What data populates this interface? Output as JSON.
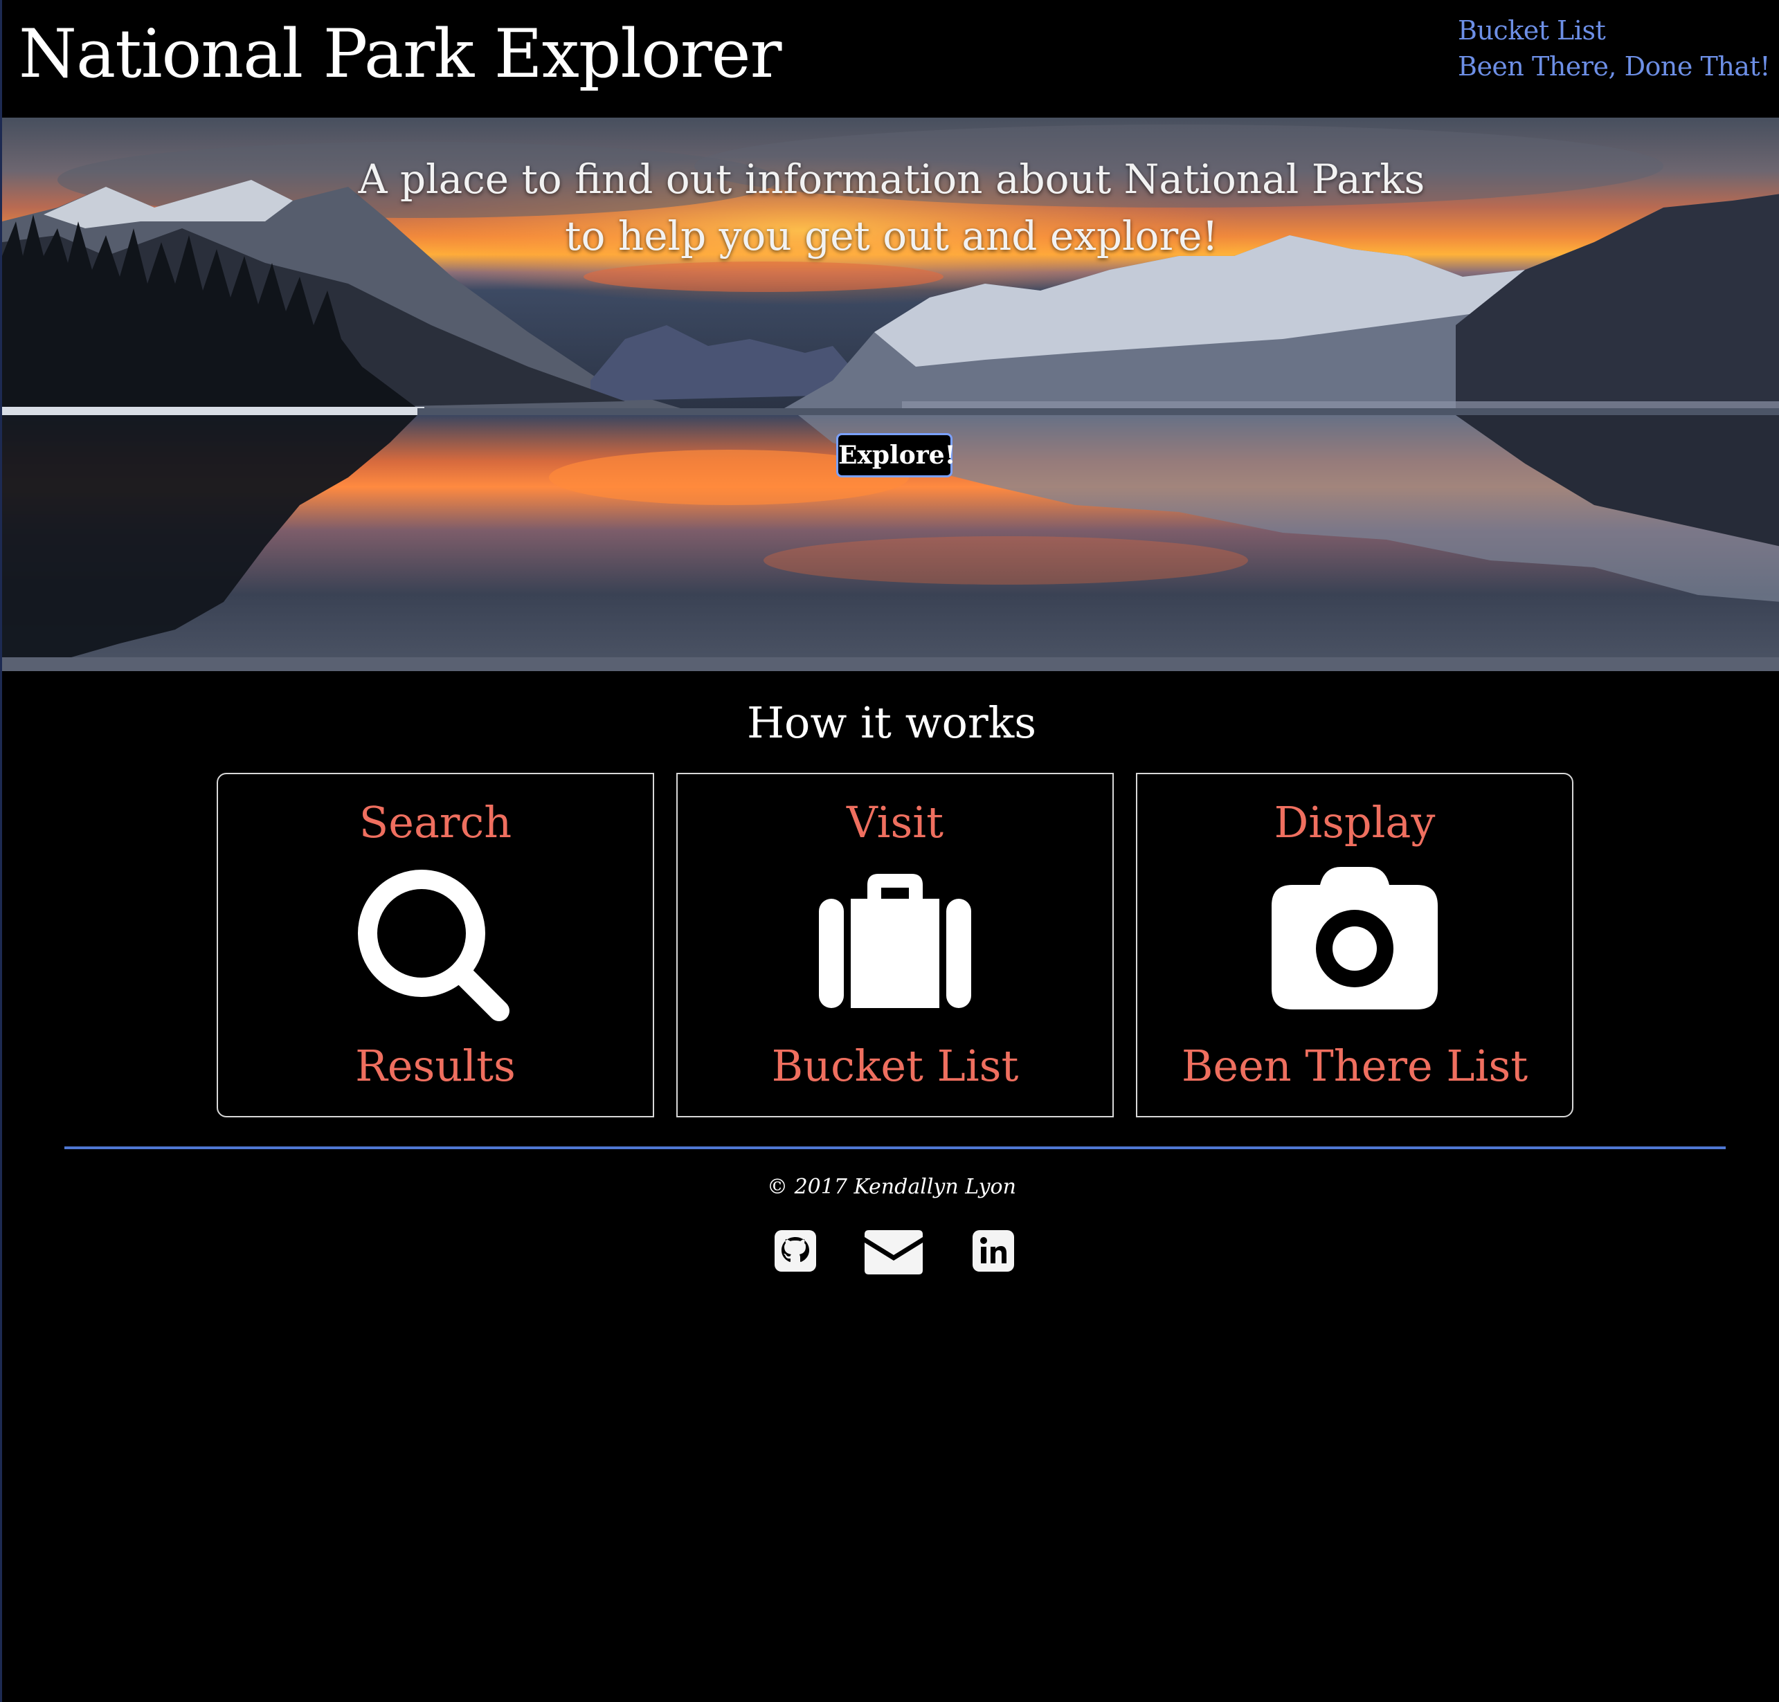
{
  "header": {
    "title": "National Park Explorer",
    "nav": [
      {
        "label": "Bucket List"
      },
      {
        "label": "Been There, Done That!"
      }
    ]
  },
  "hero": {
    "tagline_line1": "A place to find out information about National Parks",
    "tagline_line2": "to help you get out and explore!",
    "button_label": "Explore!"
  },
  "how_it_works": {
    "title": "How it works",
    "cards": [
      {
        "top": "Search",
        "bottom": "Results",
        "icon": "search-icon"
      },
      {
        "top": "Visit",
        "bottom": "Bucket List",
        "icon": "suitcase-icon"
      },
      {
        "top": "Display",
        "bottom": "Been There List",
        "icon": "camera-icon"
      }
    ]
  },
  "footer": {
    "copyright": "© 2017 Kendallyn Lyon",
    "social": [
      {
        "icon": "github-icon"
      },
      {
        "icon": "envelope-icon"
      },
      {
        "icon": "linkedin-icon"
      }
    ]
  },
  "colors": {
    "background": "#000000",
    "nav_link": "#6d8fe6",
    "card_text": "#ef6f5f",
    "divider": "#4f77d2",
    "button_border": "#7aa0ff"
  }
}
